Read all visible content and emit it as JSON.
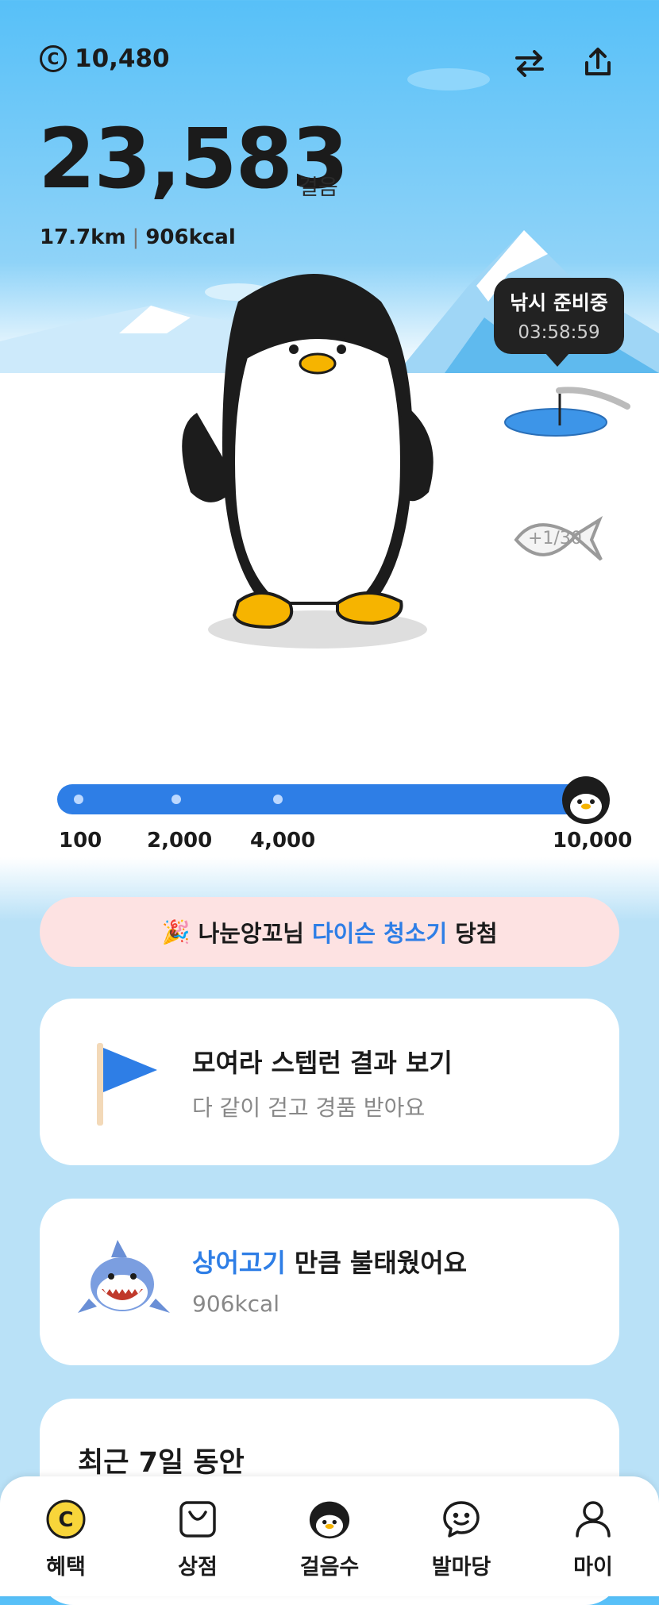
{
  "header": {
    "coin_balance": "10,480",
    "swap_icon": "swap-arrows-icon",
    "share_icon": "share-icon"
  },
  "steps": {
    "count": "23,583",
    "unit": "걸음",
    "distance": "17.7km",
    "separator": "|",
    "calories": "906kcal"
  },
  "fishing": {
    "status": "낚시 준비중",
    "timer": "03:58:59"
  },
  "progress": {
    "milestones": [
      "100",
      "2,000",
      "4,000",
      "10,000"
    ],
    "current_fraction": 1.0
  },
  "banner": {
    "emoji": "🎉",
    "prefix": "나눈앙꼬님",
    "highlight": "다이슨 청소기",
    "suffix": "당첨"
  },
  "cards": {
    "steprun": {
      "title": "모여라 스텝런 결과 보기",
      "subtitle": "다 같이 걷고 경품 받아요"
    },
    "shark": {
      "highlight": "상어고기",
      "title_rest": "만큼 불태웠어요",
      "subtitle": "906kcal"
    },
    "recent": {
      "title": "최근 7일 동안"
    }
  },
  "nav": {
    "items": [
      {
        "label": "혜택",
        "icon": "coin-icon"
      },
      {
        "label": "상점",
        "icon": "shopping-bag-icon"
      },
      {
        "label": "걸음수",
        "icon": "penguin-icon"
      },
      {
        "label": "발마당",
        "icon": "chat-smile-icon"
      },
      {
        "label": "마이",
        "icon": "person-icon"
      }
    ],
    "active_index": 2
  },
  "colors": {
    "accent": "#2e7ee6",
    "sky": "#57c0f8",
    "banner_bg": "#fde2e2"
  }
}
